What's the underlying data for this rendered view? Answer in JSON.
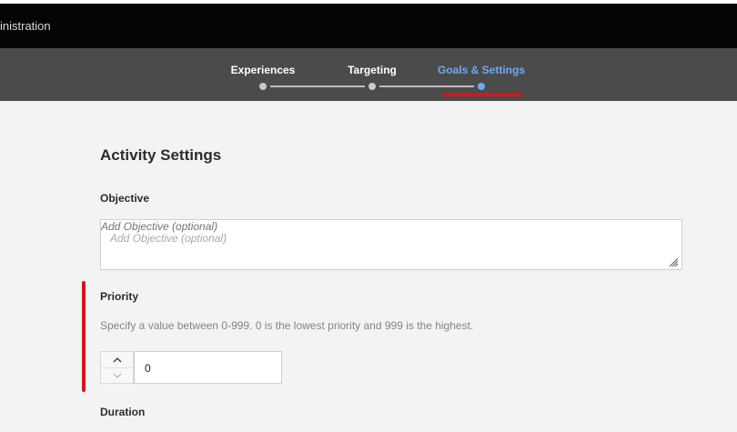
{
  "header": {
    "breadcrumb_fragment": "inistration"
  },
  "steps": [
    {
      "label": "Experiences",
      "state": "complete"
    },
    {
      "label": "Targeting",
      "state": "complete"
    },
    {
      "label": "Goals & Settings",
      "state": "active"
    }
  ],
  "colors": {
    "accent": "#6fa8ef",
    "highlight": "#d7141f",
    "topbar": "#050505",
    "stepbar": "#4b4b4b"
  },
  "page": {
    "title": "Activity Settings",
    "objective": {
      "label": "Objective",
      "placeholder": "Add Objective (optional)",
      "value": ""
    },
    "priority": {
      "label": "Priority",
      "description": "Specify a value between 0-999. 0 is the lowest priority and 999 is the highest.",
      "value": "0"
    },
    "duration": {
      "label": "Duration"
    }
  }
}
